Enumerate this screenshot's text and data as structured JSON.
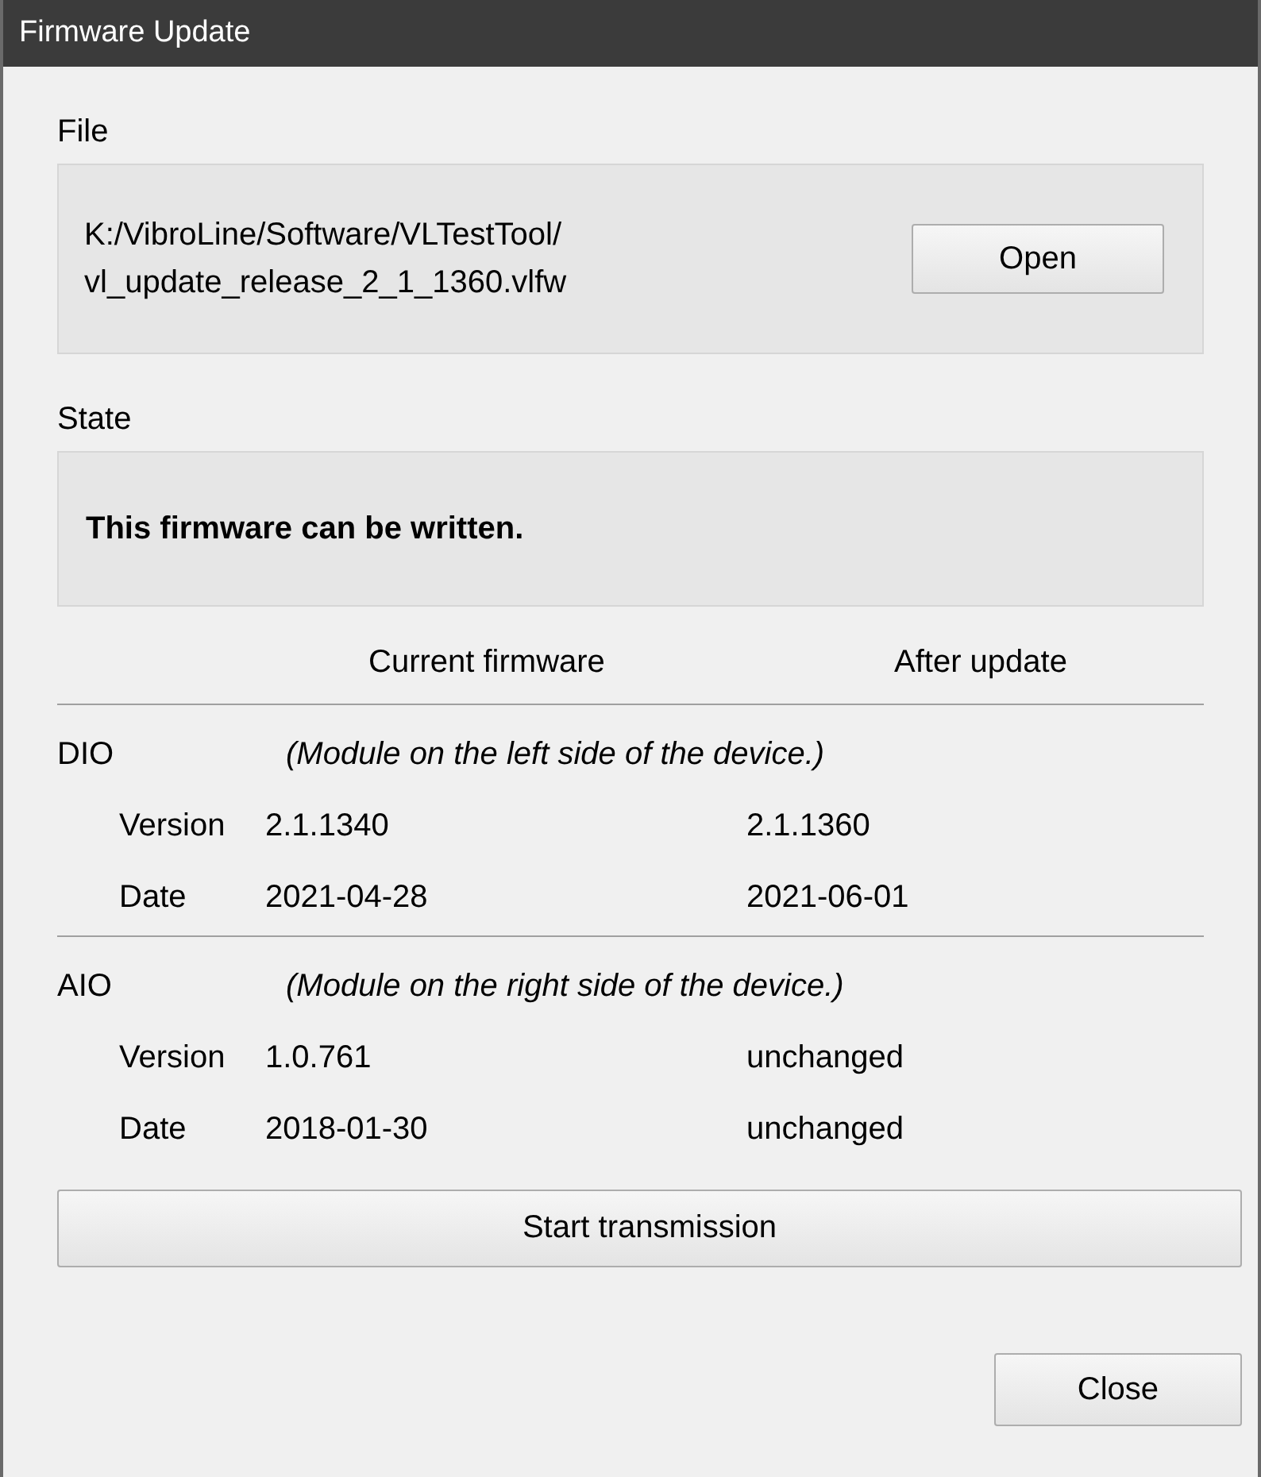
{
  "window": {
    "title": "Firmware Update"
  },
  "file": {
    "label": "File",
    "path_lines": [
      "K:/VibroLine/Software/VLTestTool/",
      "vl_update_release_2_1_1360.vlfw"
    ],
    "open_button": "Open"
  },
  "state": {
    "label": "State",
    "message": "This firmware can be written."
  },
  "columns": [
    "Current firmware",
    "After update"
  ],
  "modules": [
    {
      "name": "DIO",
      "description": "(Module on the left side of the device.)",
      "rows": [
        {
          "label": "Version",
          "current": "2.1.1340",
          "after": "2.1.1360"
        },
        {
          "label": "Date",
          "current": "2021-04-28",
          "after": "2021-06-01"
        }
      ]
    },
    {
      "name": "AIO",
      "description": "(Module on the right side of the device.)",
      "rows": [
        {
          "label": "Version",
          "current": "1.0.761",
          "after": "unchanged"
        },
        {
          "label": "Date",
          "current": "2018-01-30",
          "after": "unchanged"
        }
      ]
    }
  ],
  "start_button": "Start transmission",
  "close_button": "Close"
}
